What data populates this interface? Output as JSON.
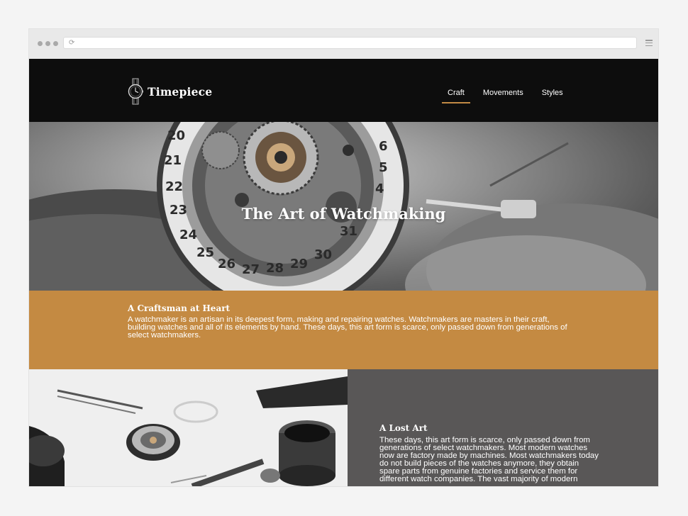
{
  "browser": {
    "dots": 3,
    "icons": [
      "reload-icon",
      "menu-icon"
    ]
  },
  "site": {
    "brand": "Timepiece",
    "nav": [
      {
        "label": "Craft",
        "active": true
      },
      {
        "label": "Movements",
        "active": false
      },
      {
        "label": "Styles",
        "active": false
      }
    ],
    "accent_color": "#c28a45"
  },
  "hero": {
    "title": "The Art of Watchmaking"
  },
  "craftsman": {
    "heading": "A Craftsman at Heart",
    "body": "A watchmaker is an artisan in its deepest form, making and repairing watches. Watchmakers are masters in their craft, building watches and all of its elements by hand. These days, this art form is scarce, only passed down from generations of select watchmakers.",
    "background": "#c48a42"
  },
  "lost_art": {
    "heading": "A Lost Art",
    "body": "These days, this art form is scarce, only passed down from generations of select watchmakers. Most modern watches now are factory made by machines. Most watchmakers today do not build pieces of the watches anymore, they obtain spare parts from genuine factories and service them for different watch companies. The vast majority of modern",
    "background": "#595757"
  }
}
